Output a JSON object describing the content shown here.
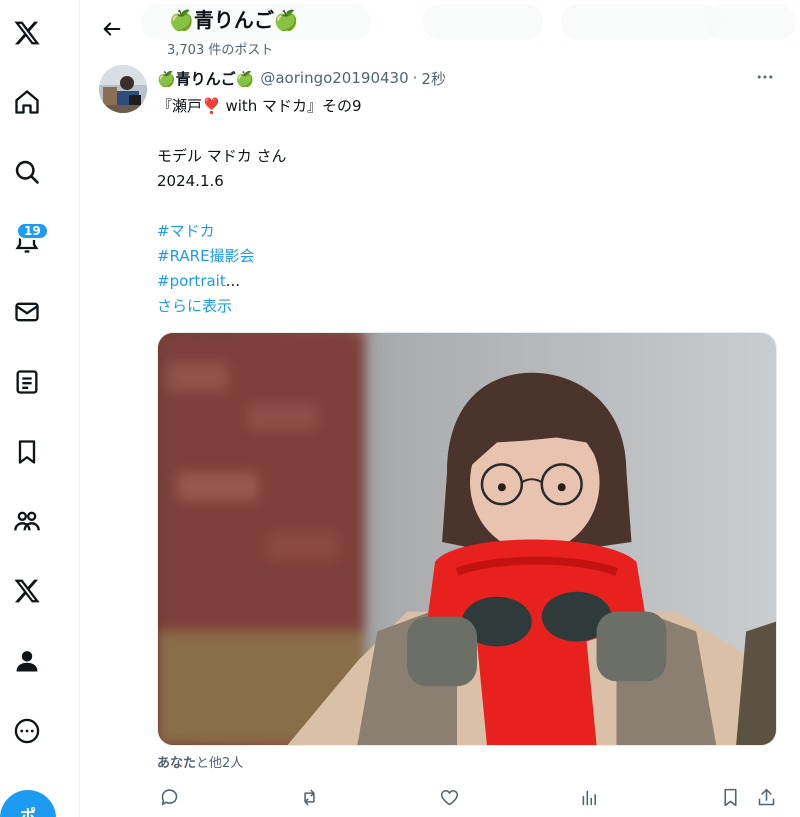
{
  "header": {
    "title": "🍏青りんご🍏",
    "post_count": "3,703 件のポスト"
  },
  "notifications": {
    "badge_count": "19"
  },
  "compose": {
    "label": "ポ"
  },
  "post": {
    "author_name": "🍏青りんご🍏",
    "handle": "@aoringo20190430",
    "separator": "·",
    "time": "2秒",
    "lines": {
      "title": "『瀬戸❣️ with マドカ』その9",
      "model": "モデル マドカ さん",
      "date": "2024.1.6"
    },
    "hashtags": [
      "#マドカ",
      "#RARE撮影会",
      "#portrait"
    ],
    "truncation": "...",
    "show_more": "さらに表示",
    "liked_by_you": "あなた",
    "liked_by_rest": "と他2人"
  },
  "icons": {
    "rail": [
      "x-logo-icon",
      "home-icon",
      "search-icon",
      "bell-icon",
      "mail-icon",
      "lists-icon",
      "bookmark-icon",
      "communities-icon",
      "premium-x-icon",
      "profile-icon",
      "more-circle-icon"
    ],
    "actions": [
      "reply-icon",
      "repost-icon",
      "like-icon",
      "views-icon",
      "bookmark-icon",
      "share-icon"
    ]
  },
  "colors": {
    "accent": "#1d9bf0",
    "text_primary": "#0f1419",
    "text_secondary": "#536471",
    "scarf": "#e8211f"
  }
}
